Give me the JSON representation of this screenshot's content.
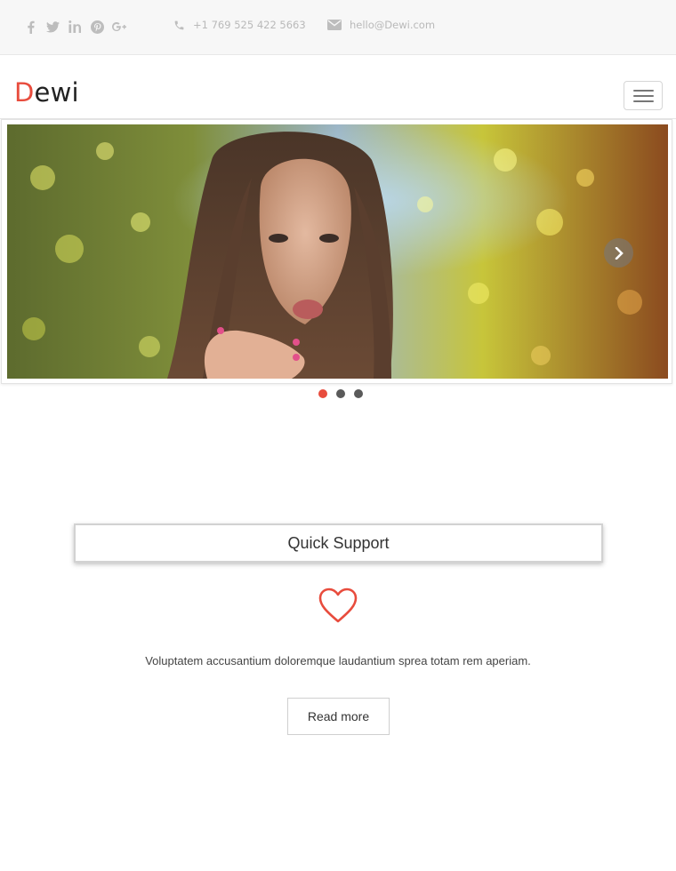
{
  "topbar": {
    "social": [
      "facebook-icon",
      "twitter-icon",
      "linkedin-icon",
      "pinterest-icon",
      "google-plus-icon"
    ],
    "phone": "+1 769 525 422 5663",
    "email": "hello@Dewi.com"
  },
  "header": {
    "logo_initial": "D",
    "logo_rest": "ewi",
    "menu_icon": "hamburger-menu-icon"
  },
  "slider": {
    "slide_count": 3,
    "active_index": 0
  },
  "feature": {
    "title": "Quick Support",
    "icon": "heart-icon",
    "description": "Voluptatem accusantium doloremque laudantium sprea totam rem aperiam.",
    "button_label": "Read more"
  },
  "colors": {
    "accent": "#e84c3d",
    "topbar_bg": "#f7f7f7",
    "muted_text": "#b9b9b9"
  }
}
